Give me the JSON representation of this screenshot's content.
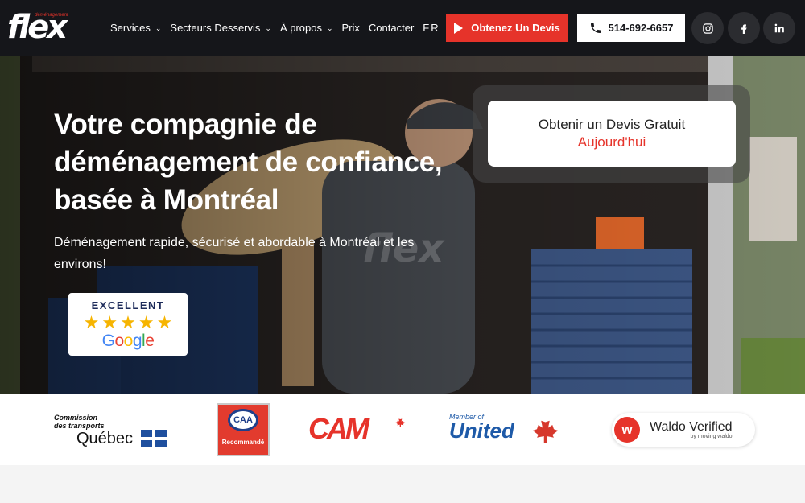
{
  "header": {
    "logo_text": "flex",
    "logo_tag": "déménagement",
    "nav": [
      {
        "label": "Services",
        "has_dropdown": true
      },
      {
        "label": "Secteurs Desservis",
        "has_dropdown": true
      },
      {
        "label": "À propos",
        "has_dropdown": true
      },
      {
        "label": "Prix",
        "has_dropdown": false
      },
      {
        "label": "Contacter",
        "has_dropdown": false
      },
      {
        "label": "FR",
        "has_dropdown": true
      }
    ],
    "quote_button": "Obtenez Un Devis",
    "phone": "514-692-6657",
    "social": [
      "instagram-icon",
      "facebook-icon",
      "linkedin-icon"
    ],
    "colors": {
      "bg": "#15161a",
      "accent": "#e6332a"
    }
  },
  "hero": {
    "title": "Votre compagnie de déménagement de confiance, basée à Montréal",
    "subtitle": "Déménagement rapide, sécurisé et abordable à Montréal et les environs!",
    "rating_label": "EXCELLENT",
    "rating_stars": 5,
    "rating_source": "Google",
    "quote_card": {
      "line1": "Obtenir un Devis Gratuit",
      "line2": "Aujourd'hui"
    },
    "shirt_text": "flex"
  },
  "partners": {
    "ctq": {
      "line1": "Commission",
      "line2": "des transports",
      "name": "Québec"
    },
    "caa": {
      "badge": "CAA",
      "label": "Recommandé"
    },
    "cam": "CAM",
    "united": {
      "small": "Member of",
      "name": "United"
    },
    "waldo": {
      "badge": "w",
      "name": "Waldo Verified",
      "by": "by moving waldo"
    }
  }
}
